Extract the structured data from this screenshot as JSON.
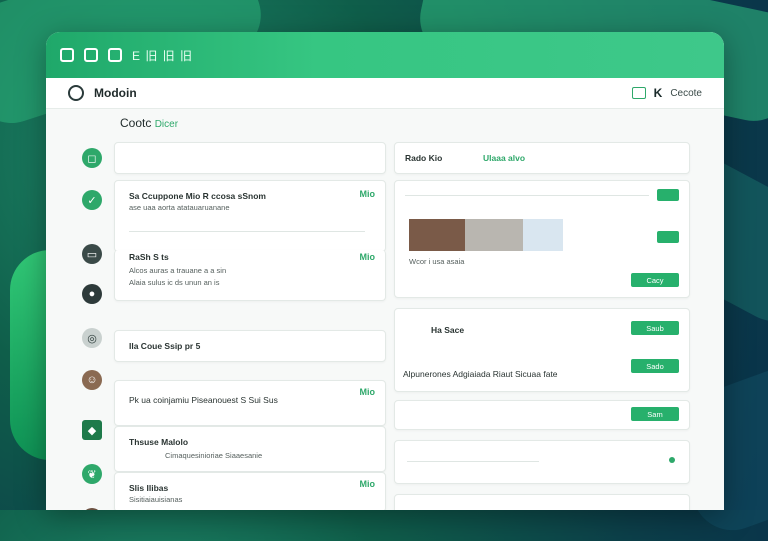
{
  "window": {
    "title": "E 旧 旧 旧"
  },
  "appbar": {
    "app_name": "Modoin",
    "right_label": "Cecote"
  },
  "section": {
    "title": "Cootc",
    "accent": "Dicer"
  },
  "left_cards": [
    {
      "lines": [
        "Sa Ccuppone Mio R ccosa sSnom",
        "ase uaa aorta atatauaruanane"
      ],
      "tag": "Mio"
    },
    {
      "lines": [
        "RaSh S ts",
        "Alcos auras a trauane a a sin",
        "Alaia sulus ic ds unun an is"
      ],
      "tag": "Mio"
    },
    {
      "lines": [
        "Ila Coue Ssip pr 5"
      ],
      "tag": ""
    },
    {
      "lines": [
        "Pk ua coinjamiu Piseanouest S Sui Sus"
      ],
      "tag": "Mio"
    },
    {
      "lines": [
        "Thsuse Malolo",
        "Cimaquesinioriae Siaaesanie"
      ],
      "tag": ""
    },
    {
      "lines": [
        "Slis Ilibas",
        "Sisitiaiauisianas"
      ],
      "tag": "Mio"
    }
  ],
  "right_cards": [
    {
      "title": "Rado Kio",
      "accent": "Ulaaa alvo",
      "btn": ""
    },
    {
      "title": "",
      "caption": "Wcor i usa asaia",
      "btn": "Cacy"
    },
    {
      "title": "Ha Sace",
      "btn": "Saub"
    },
    {
      "title": "Alpunerones Adgiaiada Riaut Sicuaa fate",
      "btn": "Sado"
    },
    {
      "title": "",
      "btn": "Sam"
    },
    {
      "title": "",
      "btn": ""
    }
  ]
}
